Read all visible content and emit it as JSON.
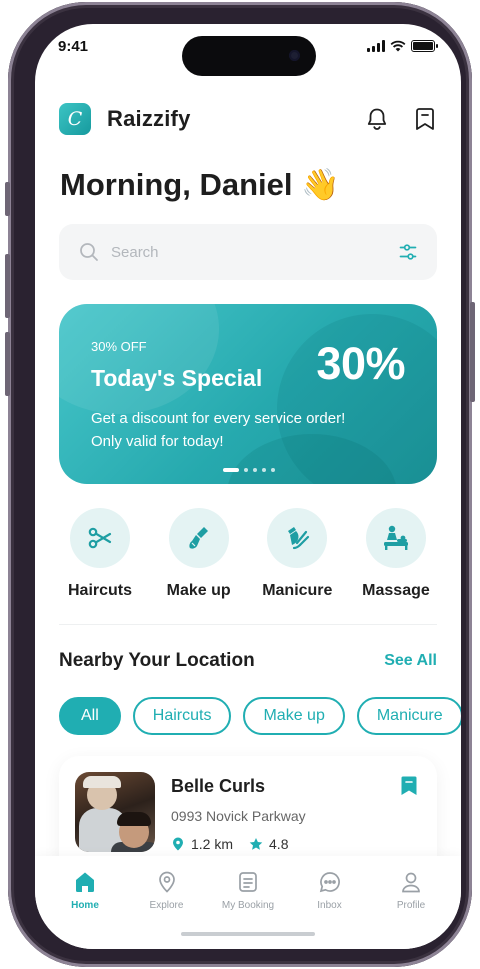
{
  "status_bar": {
    "time": "9:41"
  },
  "app": {
    "name": "Raizzify",
    "logo_letter": "C"
  },
  "greeting": {
    "text": "Morning, Daniel",
    "emoji": "👋"
  },
  "search": {
    "placeholder": "Search"
  },
  "banner": {
    "discount_label": "30% OFF",
    "title": "Today's Special",
    "percent": "30%",
    "description_line1": "Get a discount for every service order!",
    "description_line2": "Only valid for today!",
    "active_slide": 1,
    "slide_count": 5
  },
  "categories": [
    {
      "label": "Haircuts",
      "icon": "scissors-icon"
    },
    {
      "label": "Make up",
      "icon": "makeup-brush-icon"
    },
    {
      "label": "Manicure",
      "icon": "nail-polish-icon"
    },
    {
      "label": "Massage",
      "icon": "massage-icon"
    }
  ],
  "nearby": {
    "title": "Nearby Your Location",
    "see_all": "See All"
  },
  "filters": [
    "All",
    "Haircuts",
    "Make up",
    "Manicure"
  ],
  "salon": {
    "name": "Belle Curls",
    "address": "0993 Novick Parkway",
    "distance": "1.2 km",
    "rating": "4.8"
  },
  "tabbar": [
    {
      "label": "Home",
      "icon": "home-icon",
      "active": true
    },
    {
      "label": "Explore",
      "icon": "location-pin-icon",
      "active": false
    },
    {
      "label": "My Booking",
      "icon": "booking-icon",
      "active": false
    },
    {
      "label": "Inbox",
      "icon": "chat-icon",
      "active": false
    },
    {
      "label": "Profile",
      "icon": "profile-icon",
      "active": false
    }
  ],
  "colors": {
    "accent": "#20aeb2",
    "text": "#1f1f1f",
    "muted": "#9aa0a6",
    "chip_bg": "#e4f3f3"
  }
}
